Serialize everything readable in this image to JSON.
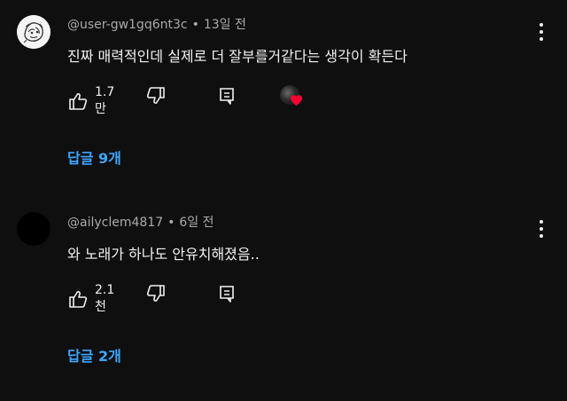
{
  "comments": [
    {
      "author": "@user-gw1gq6nt3c",
      "time": "13일 전",
      "text": "진짜 매력적인데 실제로 더 잘부를거같다는 생각이 확든다",
      "likes": "1.7만",
      "replies_label": "답글 9개",
      "hearted_by_creator": true
    },
    {
      "author": "@ailyclem4817",
      "time": "6일 전",
      "text": "와 노래가 하나도 안유치해졌음..",
      "likes": "2.1천",
      "replies_label": "답글 2개",
      "hearted_by_creator": false
    }
  ],
  "separator": "•",
  "icons": {
    "like": "thumbs-up-icon",
    "dislike": "thumbs-down-icon",
    "reply": "reply-icon",
    "more": "more-vert-icon",
    "heart": "heart-icon"
  },
  "colors": {
    "background": "#0f0f0f",
    "text": "#f1f1f1",
    "meta": "#aaaaaa",
    "link": "#3ea6ff",
    "heart": "#ff0033"
  }
}
